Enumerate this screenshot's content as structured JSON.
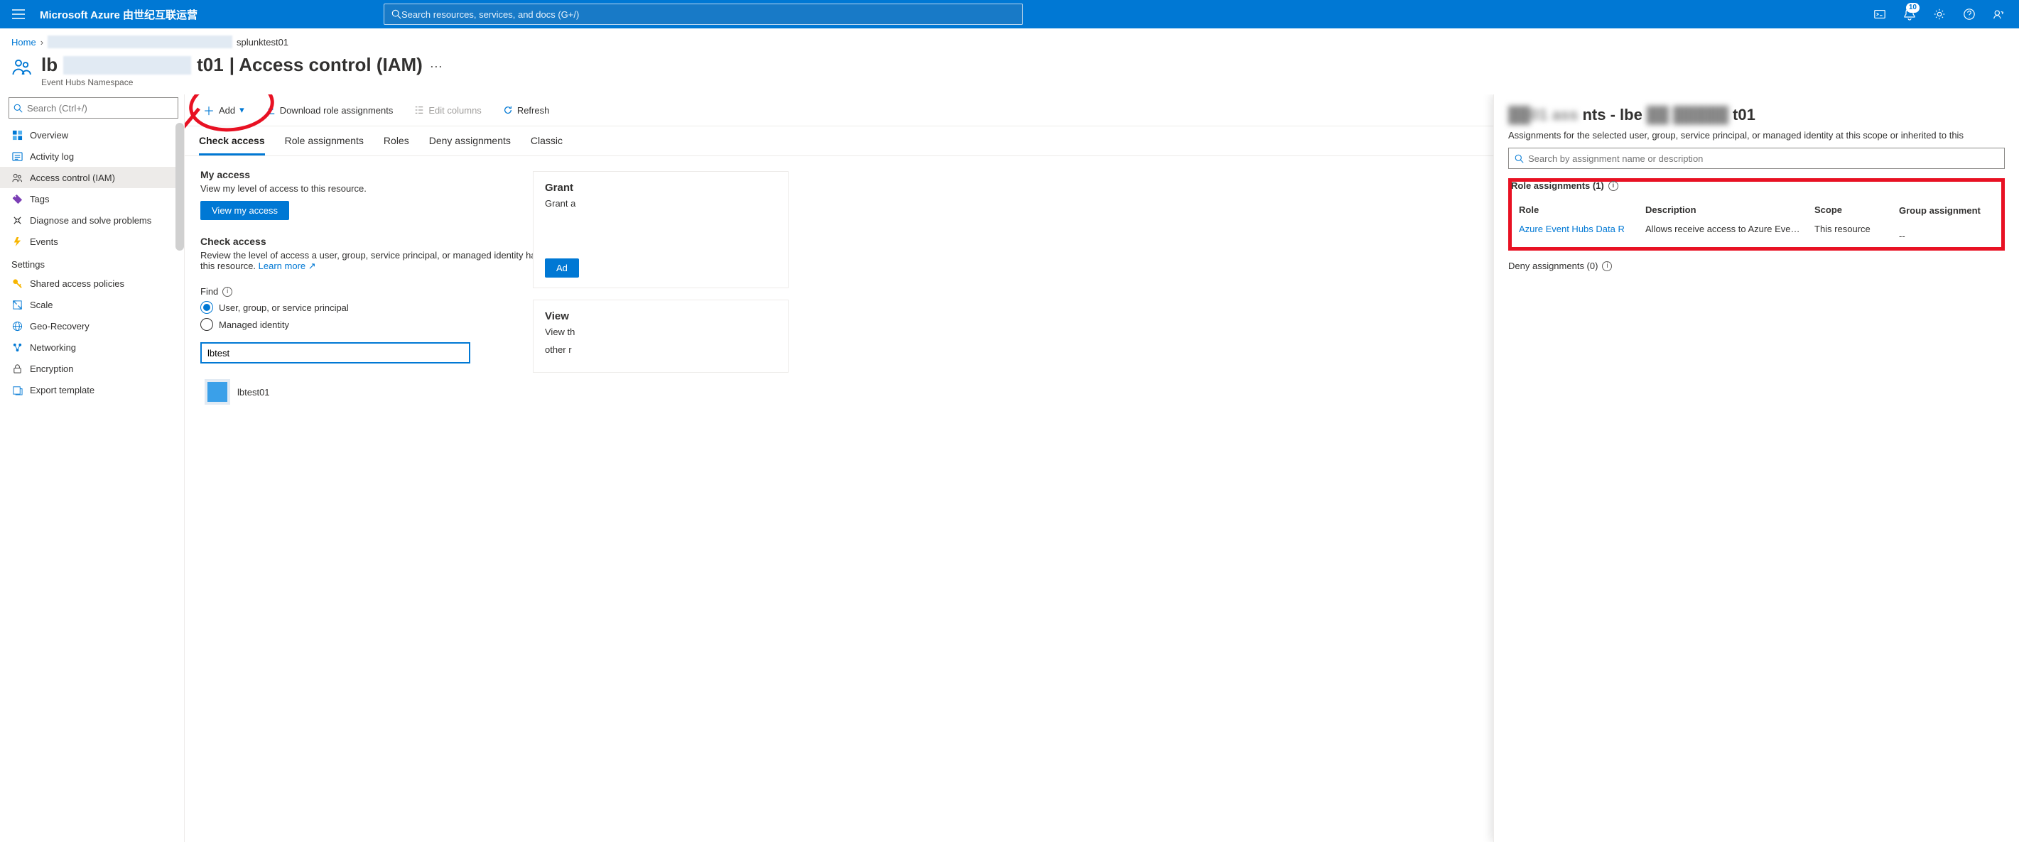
{
  "brand": "Microsoft Azure 由世纪互联运营",
  "global_search_placeholder": "Search resources, services, and docs (G+/)",
  "notification_count": "10",
  "breadcrumb": {
    "home": "Home",
    "current": "splunktest01"
  },
  "header": {
    "title_prefix": "lb",
    "title_suffix": "t01",
    "title_tail": " | Access control (IAM)",
    "subtitle": "Event Hubs Namespace"
  },
  "sidebar": {
    "search_placeholder": "Search (Ctrl+/)",
    "items": [
      {
        "label": "Overview"
      },
      {
        "label": "Activity log"
      },
      {
        "label": "Access control (IAM)"
      },
      {
        "label": "Tags"
      },
      {
        "label": "Diagnose and solve problems"
      },
      {
        "label": "Events"
      }
    ],
    "settings_label": "Settings",
    "settings_items": [
      {
        "label": "Shared access policies"
      },
      {
        "label": "Scale"
      },
      {
        "label": "Geo-Recovery"
      },
      {
        "label": "Networking"
      },
      {
        "label": "Encryption"
      },
      {
        "label": "Export template"
      }
    ]
  },
  "toolbar": {
    "add": "Add",
    "download": "Download role assignments",
    "edit_columns": "Edit columns",
    "refresh": "Refresh"
  },
  "tabs": {
    "check": "Check access",
    "role_assign": "Role assignments",
    "roles": "Roles",
    "deny": "Deny assignments",
    "classic": "Classic"
  },
  "check_access": {
    "my_access_title": "My access",
    "my_access_sub": "View my level of access to this resource.",
    "view_my_access_btn": "View my access",
    "check_title": "Check access",
    "check_sub_1": "Review the level of access a user, group, service principal, or managed identity has to this resource. ",
    "learn_more": "Learn more",
    "find_label": "Find",
    "radio_user": "User, group, or service principal",
    "radio_mi": "Managed identity",
    "find_value": "lbtest",
    "result_name": "lbtest01"
  },
  "cards": {
    "grant_title": "Grant",
    "grant_sub": "Grant a",
    "grant_btn": "Ad",
    "view_title": "View",
    "view_sub1": "View th",
    "view_sub2": "other r"
  },
  "flyout": {
    "title_mid": "nts - lbe",
    "title_suffix": "t01",
    "sub": "Assignments for the selected user, group, service principal, or managed identity at this scope or inherited to this",
    "search_placeholder": "Search by assignment name or description",
    "role_assignments_label": "Role assignments (1)",
    "table": {
      "col_role": "Role",
      "col_desc": "Description",
      "col_scope": "Scope",
      "col_group": "Group assignment",
      "row_role": "Azure Event Hubs Data R",
      "row_desc": "Allows receive access to Azure Eve…",
      "row_scope": "This resource",
      "row_group": "--"
    },
    "deny_label": "Deny assignments (0)"
  }
}
